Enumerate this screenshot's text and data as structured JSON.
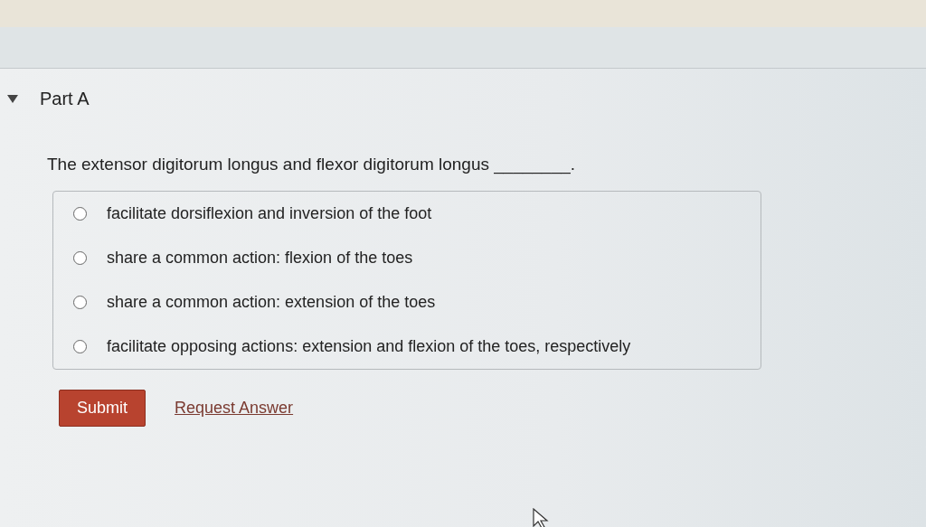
{
  "part": {
    "title": "Part A",
    "expanded": true
  },
  "question": {
    "text": "The extensor digitorum longus and flexor digitorum longus",
    "blank": "________."
  },
  "options": [
    {
      "label": "facilitate dorsiflexion and inversion of the foot",
      "selected": false
    },
    {
      "label": "share a common action: flexion of the toes",
      "selected": false
    },
    {
      "label": "share a common action: extension of the toes",
      "selected": false
    },
    {
      "label": "facilitate opposing actions: extension and flexion of the toes, respectively",
      "selected": false
    }
  ],
  "buttons": {
    "submit": "Submit",
    "request": "Request Answer"
  }
}
